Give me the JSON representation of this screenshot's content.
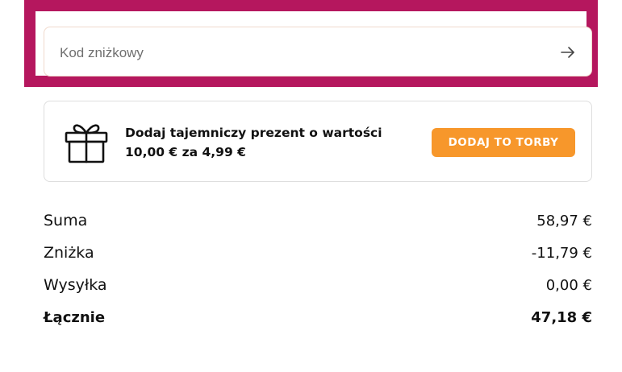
{
  "discount": {
    "placeholder": "Kod zniżkowy",
    "value": ""
  },
  "gift_offer": {
    "text_line1": "Dodaj tajemniczy prezent o wartości",
    "text_line2": "10,00 € za 4,99 €",
    "button_label": "DODAJ TO TORBY"
  },
  "summary": {
    "rows": [
      {
        "label": "Suma",
        "value": "58,97 €"
      },
      {
        "label": "Zniżka",
        "value": "-11,79 €"
      },
      {
        "label": "Wysyłka",
        "value": "0,00 €"
      }
    ],
    "total": {
      "label": "Łącznie",
      "value": "47,18 €"
    }
  },
  "colors": {
    "highlight": "#b5175e",
    "button": "#f7972b"
  },
  "icons": [
    "arrow-right-icon",
    "gift-icon"
  ]
}
